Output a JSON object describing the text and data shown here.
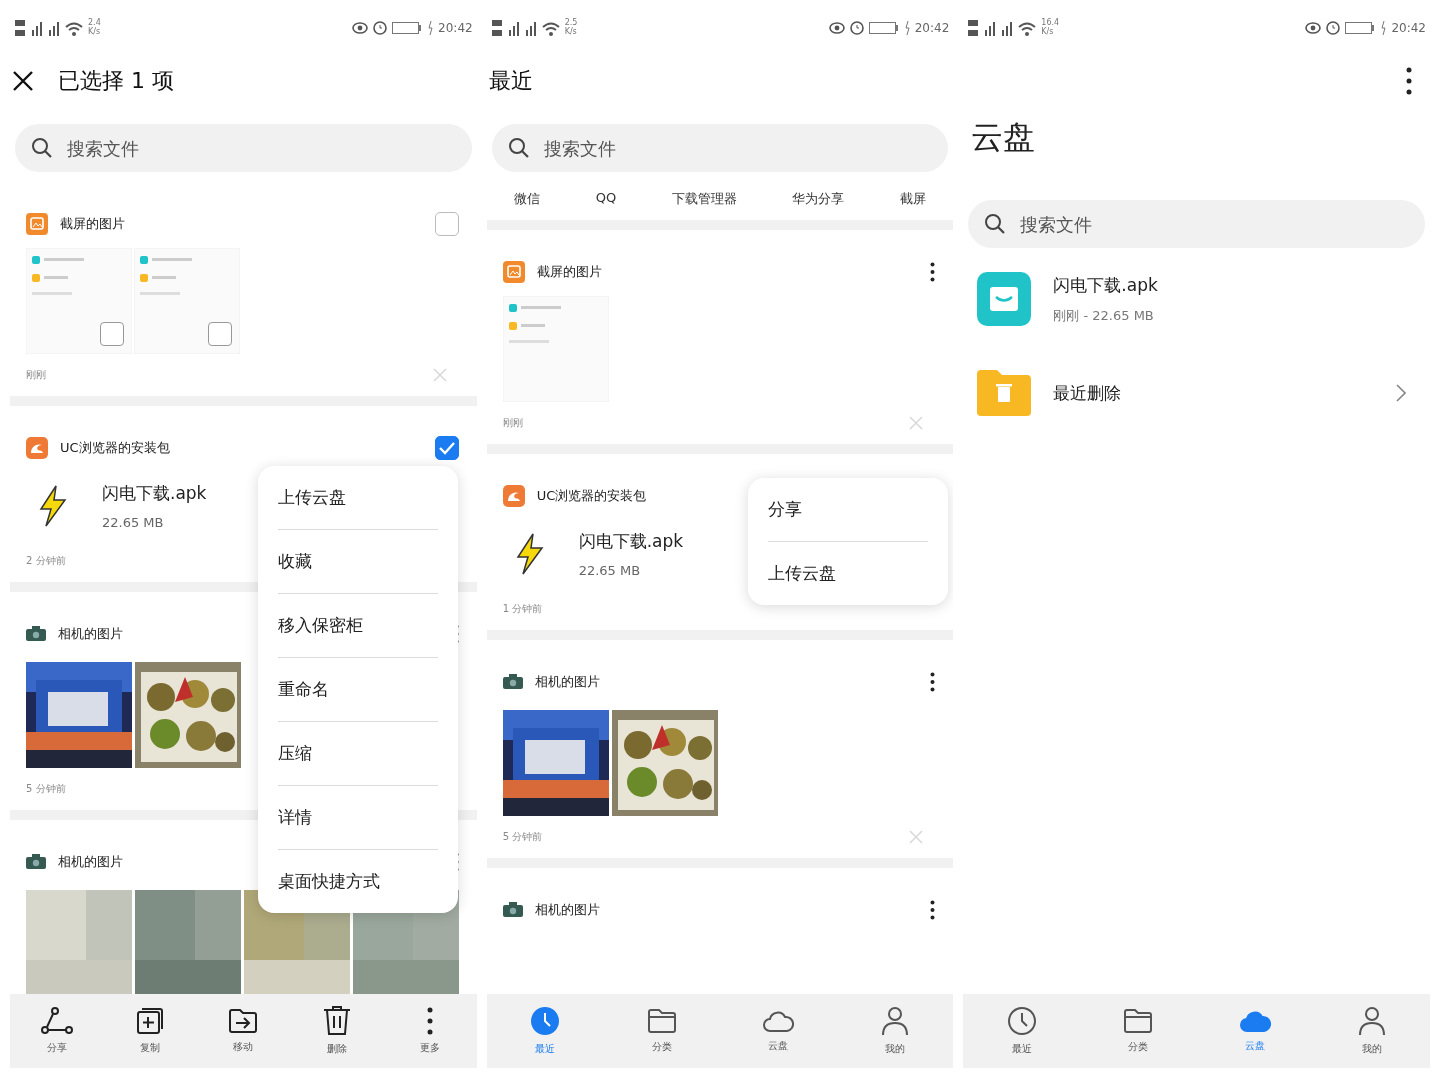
{
  "panels": [
    {
      "kind": "selection",
      "status_bar": {
        "speed": "2.4",
        "unit": "K/s",
        "time": "20:42"
      },
      "title": "已选择 1 项",
      "search": {
        "placeholder": "搜索文件"
      },
      "groups": [
        {
          "source": "截屏的图片",
          "checked": false,
          "kind": "screens",
          "items": [
            {
              "checked": false
            },
            {
              "checked": false
            }
          ],
          "time": "刚刚",
          "dismiss": true
        },
        {
          "source": "UC浏览器的安装包",
          "checked": true,
          "kind": "file",
          "file": {
            "name": "闪电下载.apk",
            "size": "22.65 MB"
          },
          "time": "2 分钟前",
          "dismiss": false
        },
        {
          "source": "相机的图片",
          "kind": "photos",
          "time": "5 分钟前",
          "dismiss": false
        },
        {
          "source": "相机的图片",
          "kind": "photos"
        }
      ],
      "menu": [
        "上传云盘",
        "收藏",
        "移入保密柜",
        "重命名",
        "压缩",
        "详情",
        "桌面快捷方式"
      ],
      "bottom": [
        {
          "label": "分享",
          "selected": false
        },
        {
          "label": "复制",
          "selected": false
        },
        {
          "label": "移动",
          "selected": false
        },
        {
          "label": "删除",
          "selected": false
        },
        {
          "label": "更多",
          "selected": false
        }
      ]
    },
    {
      "kind": "recent",
      "status_bar": {
        "speed": "2.5",
        "unit": "K/s",
        "time": "20:42"
      },
      "title": "最近",
      "search": {
        "placeholder": "搜索文件"
      },
      "sources": [
        "微信",
        "QQ",
        "下载管理器",
        "华为分享",
        "截屏"
      ],
      "groups": [
        {
          "source": "截屏的图片",
          "kind": "screens",
          "items": [
            {
              "kind": "screenshot"
            }
          ],
          "time": "刚刚",
          "dismiss": true
        },
        {
          "source": "UC浏览器的安装包",
          "kind": "file",
          "file": {
            "name": "闪电下载.apk",
            "size": "22.65 MB"
          },
          "time": "1 分钟前",
          "dismiss": false
        },
        {
          "source": "相机的图片",
          "kind": "photos",
          "time": "5 分钟前",
          "dismiss": true
        },
        {
          "source": "相机的图片",
          "kind": "photos"
        }
      ],
      "menu": [
        "分享",
        "上传云盘"
      ],
      "bottom": [
        {
          "label": "最近",
          "selected": true
        },
        {
          "label": "分类",
          "selected": false
        },
        {
          "label": "云盘",
          "selected": false
        },
        {
          "label": "我的",
          "selected": false
        }
      ]
    },
    {
      "kind": "cloud",
      "status_bar": {
        "speed": "16.4",
        "unit": "K/s",
        "time": "20:42"
      },
      "title": "云盘",
      "search": {
        "placeholder": "搜索文件"
      },
      "files": [
        {
          "name": "闪电下载.apk",
          "meta": "刚刚 - 22.65 MB",
          "chevron": false
        },
        {
          "name": "最近删除",
          "chevron": true
        }
      ],
      "bottom": [
        {
          "label": "最近",
          "selected": false
        },
        {
          "label": "分类",
          "selected": false
        },
        {
          "label": "云盘",
          "selected": true
        },
        {
          "label": "我的",
          "selected": false
        }
      ]
    }
  ]
}
